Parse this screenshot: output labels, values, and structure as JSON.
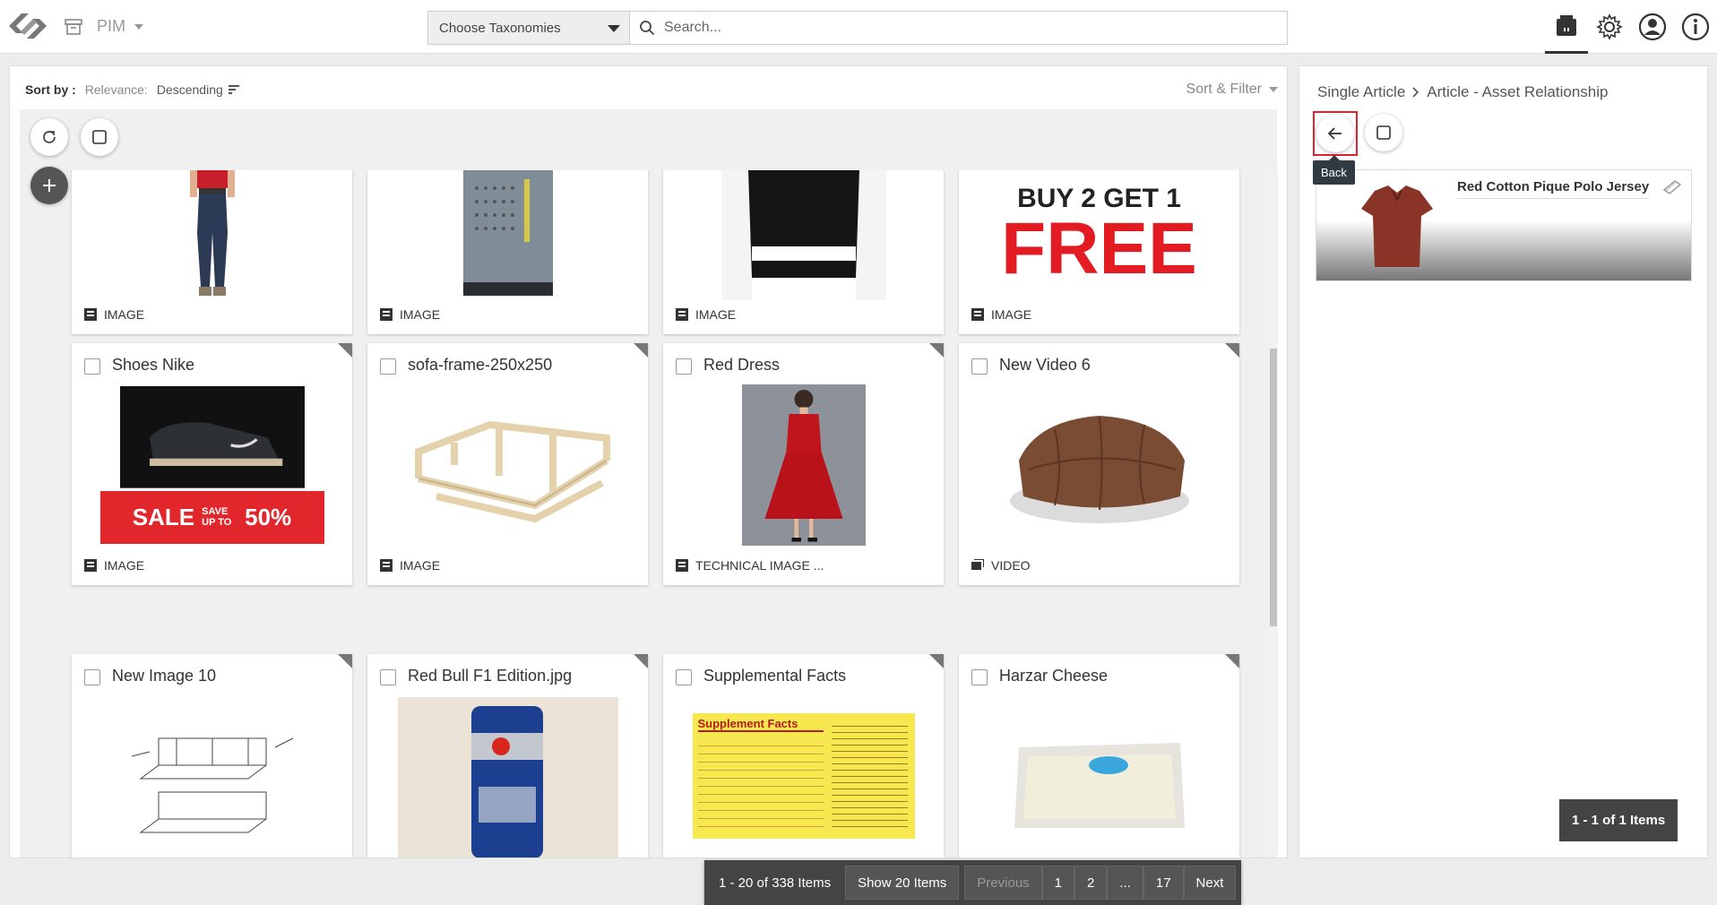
{
  "header": {
    "app_name": "PIM",
    "taxonomy_placeholder": "Choose Taxonomies",
    "search_placeholder": "Search..."
  },
  "sort": {
    "label": "Sort by :",
    "field": "Relevance:",
    "direction": "Descending",
    "sort_filter": "Sort & Filter"
  },
  "cards": [
    {
      "title": "",
      "type": "IMAGE"
    },
    {
      "title": "",
      "type": "IMAGE"
    },
    {
      "title": "",
      "type": "IMAGE"
    },
    {
      "title": "",
      "type": "IMAGE",
      "thumb_text_1": "BUY 2 GET 1",
      "thumb_text_2": "FREE"
    },
    {
      "title": "Shoes Nike",
      "type": "IMAGE",
      "thumb_text_1": "SALE",
      "thumb_text_2": "SAVE UP TO",
      "thumb_text_3": "50%"
    },
    {
      "title": "sofa-frame-250x250",
      "type": "IMAGE"
    },
    {
      "title": "Red Dress",
      "type": "TECHNICAL IMAGE ..."
    },
    {
      "title": "New Video 6",
      "type": "VIDEO"
    },
    {
      "title": "New Image 10",
      "type": ""
    },
    {
      "title": "Red Bull F1 Edition.jpg",
      "type": ""
    },
    {
      "title": "Supplemental Facts",
      "type": "",
      "thumb_text_1": "Supplement Facts"
    },
    {
      "title": "Harzar Cheese",
      "type": ""
    }
  ],
  "pager": {
    "count": "1 - 20 of 338 Items",
    "show": "Show 20 Items",
    "previous": "Previous",
    "pages": [
      "1",
      "2",
      "...",
      "17"
    ],
    "next": "Next"
  },
  "right_panel": {
    "crumb_1": "Single Article",
    "crumb_2": "Article - Asset Relationship",
    "tooltip": "Back",
    "item_name": "Red Cotton Pique Polo Jersey",
    "count": "1 - 1 of 1 Items"
  },
  "colors": {
    "accent_red": "#d9232e",
    "dark": "#444444"
  }
}
